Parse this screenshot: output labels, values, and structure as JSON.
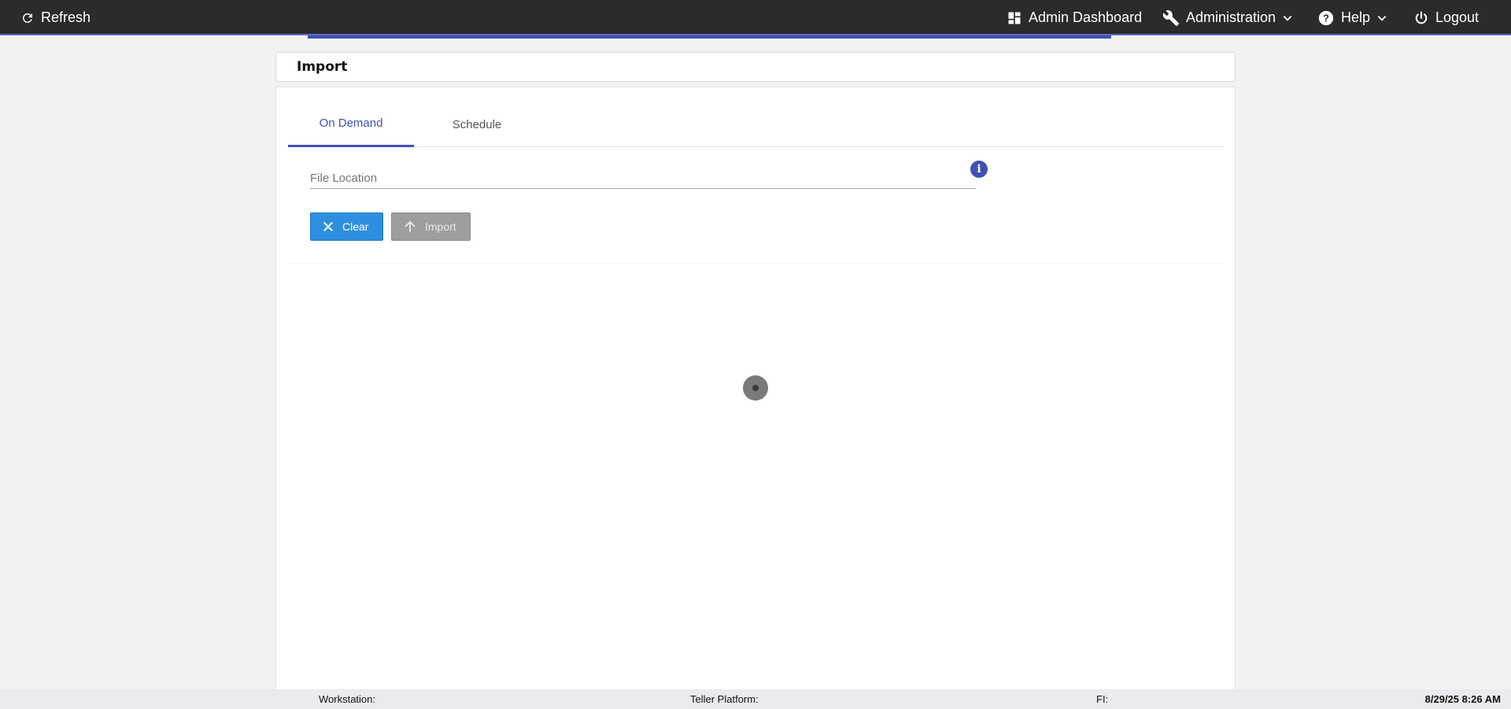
{
  "topbar": {
    "refresh_label": "Refresh",
    "dashboard_label": "Admin Dashboard",
    "administration_label": "Administration",
    "help_label": "Help",
    "logout_label": "Logout"
  },
  "header": {
    "title": "Import"
  },
  "tabs": [
    {
      "label": "On Demand",
      "active": true
    },
    {
      "label": "Schedule",
      "active": false
    }
  ],
  "form": {
    "file_location": {
      "placeholder": "File Location",
      "value": ""
    },
    "info_icon": "i",
    "clear_label": "Clear",
    "import_label": "Import"
  },
  "statusbar": {
    "workstation": "Workstation:",
    "teller_platform": "Teller Platform:",
    "fi": "FI:",
    "datetime": "8/29/25 8:26 AM"
  },
  "colors": {
    "accent": "#3f51b5",
    "topbar": "#2b2b2b",
    "clear_button": "#2e8fe0",
    "disabled_button": "#9e9e9e"
  },
  "icons": [
    "refresh-icon",
    "dashboard-icon",
    "wrench-icon",
    "help-icon",
    "power-icon",
    "chevron-down-icon",
    "close-icon",
    "arrow-up-icon",
    "info-icon",
    "loading-spinner"
  ]
}
